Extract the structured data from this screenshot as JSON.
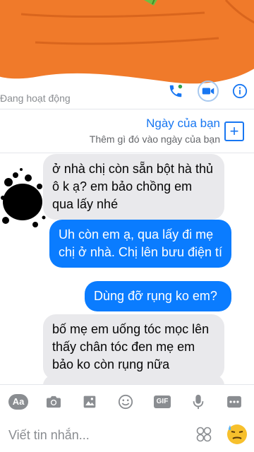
{
  "header": {
    "status": "Đang hoạt động",
    "icons": [
      "phone-icon",
      "video-icon",
      "info-icon"
    ]
  },
  "day_banner": {
    "title": "Ngày của bạn",
    "subtitle": "Thêm gì đó vào ngày của bạn",
    "add_symbol": "+"
  },
  "messages": [
    {
      "side": "in",
      "text": "ở nhà chị còn sẵn bột hà thủ ô k ạ? em bảo chồng em qua lấy nhé"
    },
    {
      "side": "out",
      "text": "Uh còn em ạ, qua lấy đi mẹ chị ở nhà. Chị lên bưu điện tí"
    },
    {
      "side": "out",
      "text": "Dùng đỡ rụng ko em?"
    },
    {
      "side": "in",
      "text": "bố mẹ em uống tóc mọc lên thấy chân tóc đen mẹ em bảo ko còn rụng nữa"
    }
  ],
  "toolbar": {
    "icons": [
      "text-format-icon",
      "camera-icon",
      "image-icon",
      "emoji-icon",
      "gif-icon",
      "microphone-icon",
      "more-icon"
    ],
    "text_format_label": "Aa",
    "gif_label": "GIF"
  },
  "input": {
    "placeholder": "Viết tin nhắn..."
  },
  "colors": {
    "accent": "#1877f2",
    "outgoing_bubble": "#0a7cff",
    "incoming_bubble": "#e9e9ec",
    "sticker": "#f07a2a"
  }
}
